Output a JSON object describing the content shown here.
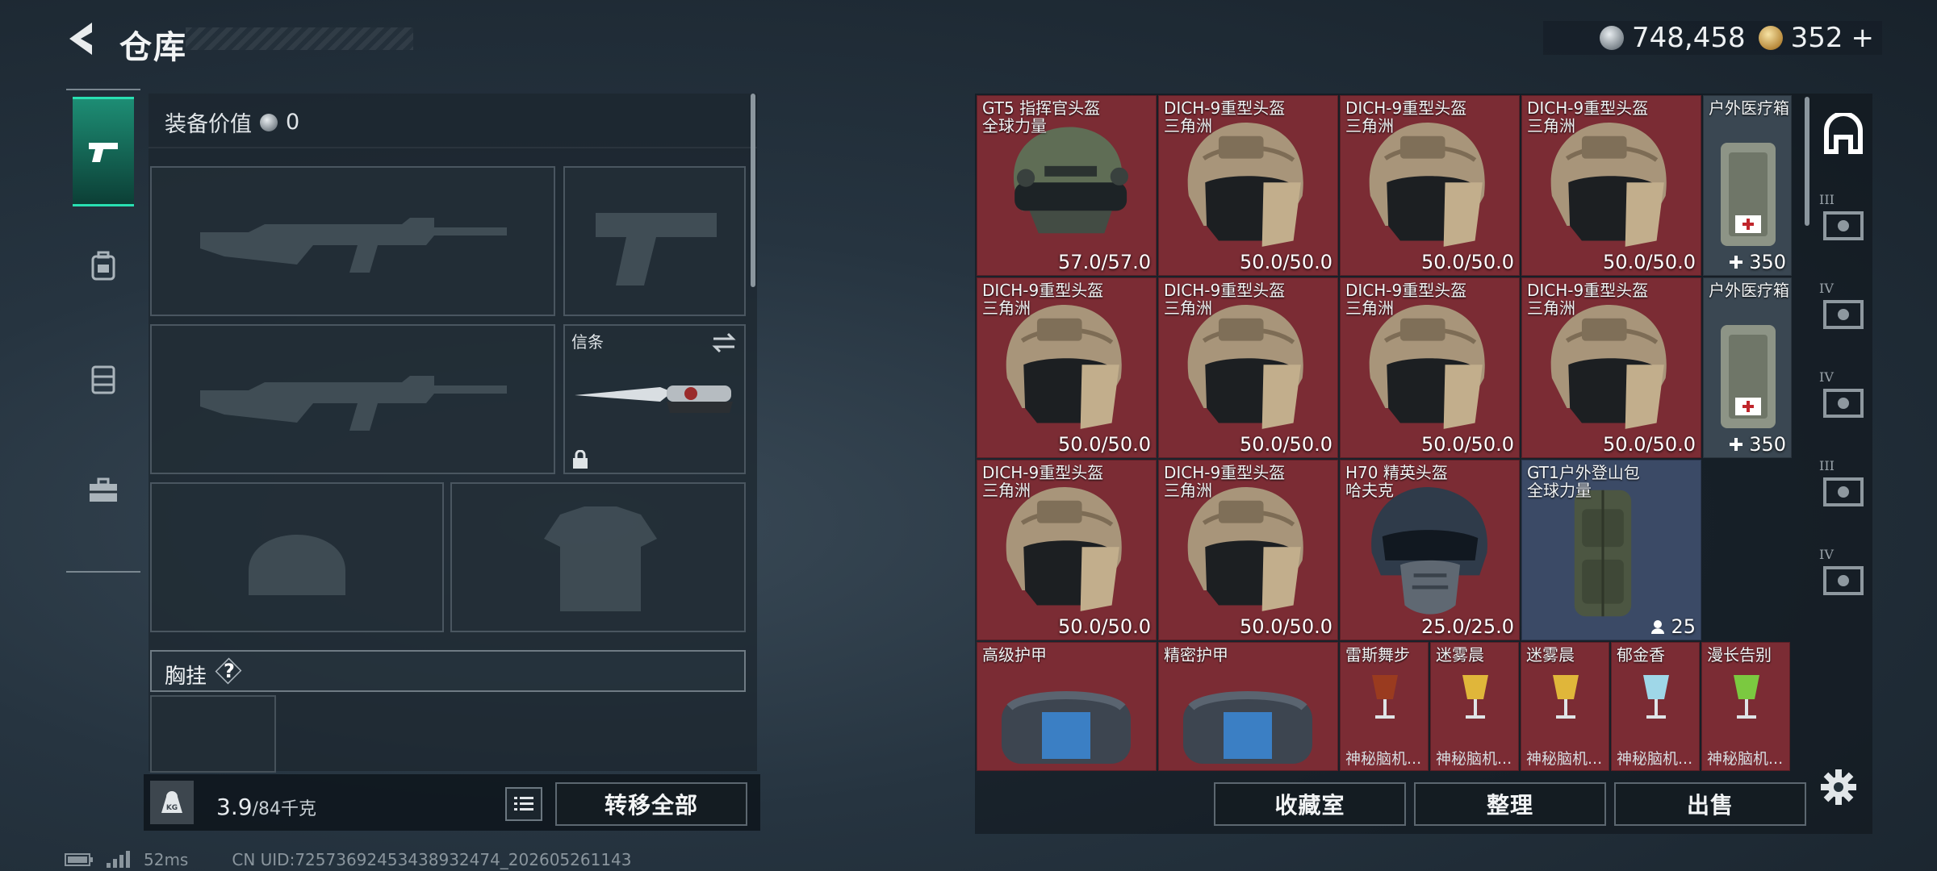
{
  "header": {
    "title": "仓库",
    "currency_silver": "748,458",
    "currency_gold": "352",
    "currency_add": "+"
  },
  "loadout": {
    "equip_value_label": "装备价值",
    "equip_value": "0",
    "melee_label": "信条",
    "chest_label": "胸挂",
    "chest_help": "?",
    "weight_current": "3.9",
    "weight_max": "/84千克",
    "transfer_all": "转移全部"
  },
  "stash": {
    "rows": [
      [
        {
          "name": "GT5 指挥官头盔",
          "sub": "全球力量",
          "value": "57.0/57.0",
          "icon": "commander-helmet"
        },
        {
          "name": "DICH-9重型头盔",
          "sub": "三角洲",
          "value": "50.0/50.0",
          "icon": "heavy-helmet"
        },
        {
          "name": "DICH-9重型头盔",
          "sub": "三角洲",
          "value": "50.0/50.0",
          "icon": "heavy-helmet"
        },
        {
          "name": "DICH-9重型头盔",
          "sub": "三角洲",
          "value": "50.0/50.0",
          "icon": "heavy-helmet"
        }
      ],
      [
        {
          "name": "DICH-9重型头盔",
          "sub": "三角洲",
          "value": "50.0/50.0",
          "icon": "heavy-helmet"
        },
        {
          "name": "DICH-9重型头盔",
          "sub": "三角洲",
          "value": "50.0/50.0",
          "icon": "heavy-helmet"
        },
        {
          "name": "DICH-9重型头盔",
          "sub": "三角洲",
          "value": "50.0/50.0",
          "icon": "heavy-helmet"
        },
        {
          "name": "DICH-9重型头盔",
          "sub": "三角洲",
          "value": "50.0/50.0",
          "icon": "heavy-helmet"
        }
      ],
      [
        {
          "name": "DICH-9重型头盔",
          "sub": "三角洲",
          "value": "50.0/50.0",
          "icon": "heavy-helmet"
        },
        {
          "name": "DICH-9重型头盔",
          "sub": "三角洲",
          "value": "50.0/50.0",
          "icon": "heavy-helmet"
        },
        {
          "name": "H70 精英头盔",
          "sub": "哈夫克",
          "value": "25.0/25.0",
          "icon": "elite-helmet"
        },
        {
          "name": "GT1户外登山包",
          "sub": "全球力量",
          "value": "25",
          "icon": "backpack"
        }
      ]
    ],
    "medkits": [
      {
        "name": "户外医疗箱",
        "value": "350"
      },
      {
        "name": "户外医疗箱",
        "value": "350"
      }
    ],
    "armor": [
      {
        "name": "高级护甲"
      },
      {
        "name": "精密护甲"
      }
    ],
    "drinks": [
      {
        "name": "雷斯舞步",
        "bottom": "神秘脑机..."
      },
      {
        "name": "迷雾晨",
        "bottom": "神秘脑机..."
      },
      {
        "name": "迷雾晨",
        "bottom": "神秘脑机..."
      },
      {
        "name": "郁金香",
        "bottom": "神秘脑机..."
      },
      {
        "name": "漫长告别",
        "bottom": "神秘脑机..."
      }
    ],
    "buttons": {
      "collection": "收藏室",
      "sort": "整理",
      "sell": "出售"
    }
  },
  "filters": [
    "III",
    "IV",
    "IV",
    "III",
    "IV"
  ],
  "status": {
    "ping": "52ms",
    "uid": "CN UID:7257369245343893247​4_202605261143"
  },
  "colors": {
    "accent": "#29e0b2",
    "item_red": "#7b2c34",
    "item_navy": "#3b4a66"
  }
}
